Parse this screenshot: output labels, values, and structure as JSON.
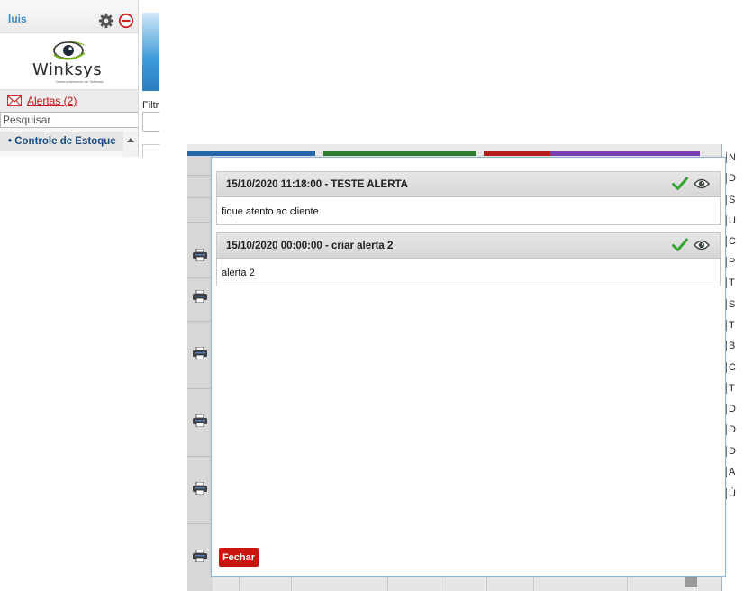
{
  "sidebar": {
    "user_name": "luis",
    "logo_text_main": "Winksys",
    "logo_text_sub": "Desenvolvimento de Software",
    "alerts_label": "Alertas (2)",
    "search_placeholder": "Pesquisar",
    "menu_item_label": "• Controle de Estoque"
  },
  "pane": {
    "filter_label": "Filtro"
  },
  "right_column": {
    "letters": [
      "N",
      "D",
      "S",
      "U",
      "C",
      "P",
      "T",
      "S",
      "T",
      "B",
      "C",
      "T",
      "D",
      "D",
      "D",
      "A",
      "Ú"
    ]
  },
  "modal": {
    "alerts": [
      {
        "title": "15/10/2020 11:18:00 - TESTE ALERTA",
        "text": "fique atento ao cliente"
      },
      {
        "title": "15/10/2020 00:00:00 - criar alerta 2",
        "text": "alerta 2"
      }
    ],
    "close_label": "Fechar"
  },
  "colors": {
    "accent_blue": "#3b8bc9",
    "alert_red": "#c11111",
    "close_button": "#c8150e",
    "check_green": "#3aa336",
    "bar_blue": "#2266a8",
    "bar_green": "#2e7d32",
    "bar_red": "#b71c1c",
    "bar_purple": "#7b3fb0"
  },
  "icons": [
    "gear-icon",
    "logout-icon",
    "mail-icon",
    "check-icon",
    "eye-icon",
    "printer-icon"
  ]
}
